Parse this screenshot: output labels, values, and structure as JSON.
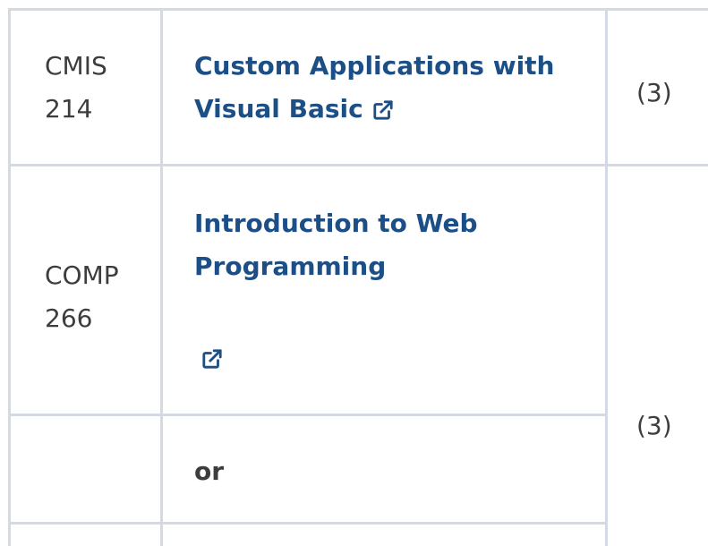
{
  "rows": [
    {
      "code_line1": "CMIS",
      "code_line2": "214",
      "title_line1": "Custom Applications with",
      "title_line2": "Visual Basic",
      "credits": "(3)"
    },
    {
      "code_line1": "COMP",
      "code_line2": "266",
      "title_line1": "Introduction to Web",
      "title_line2": "Programming",
      "credits": "(3)"
    }
  ],
  "separator": {
    "text": "or"
  },
  "colors": {
    "link": "#1c4f86",
    "text": "#3d3d3d",
    "border": "#d4dae3"
  },
  "icons": {
    "external_link": "external-link-icon"
  }
}
